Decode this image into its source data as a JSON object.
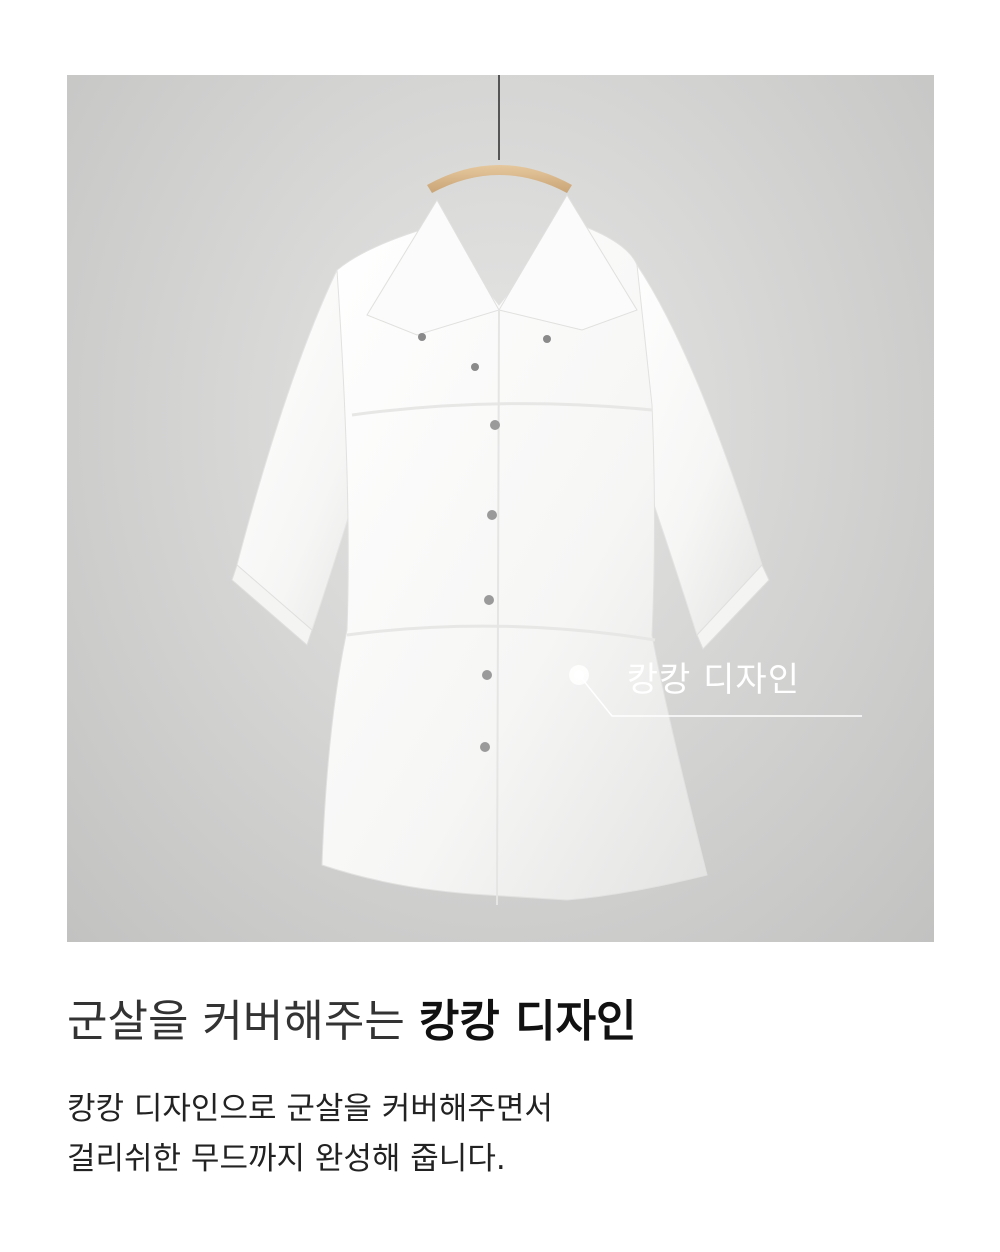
{
  "image": {
    "alt": "White short-sleeve tiered blouse on wooden hanger",
    "background_color": "#d6d6d5",
    "garment_color": "#ffffff",
    "hanger_color": "#d9b98f"
  },
  "callout": {
    "label": "캉캉 디자인"
  },
  "headline": {
    "light": "군살을 커버해주는",
    "bold": "캉캉 디자인"
  },
  "body": {
    "line1": "캉캉 디자인으로 군살을 커버해주면서",
    "line2": "걸리쉬한 무드까지 완성해 줍니다."
  }
}
